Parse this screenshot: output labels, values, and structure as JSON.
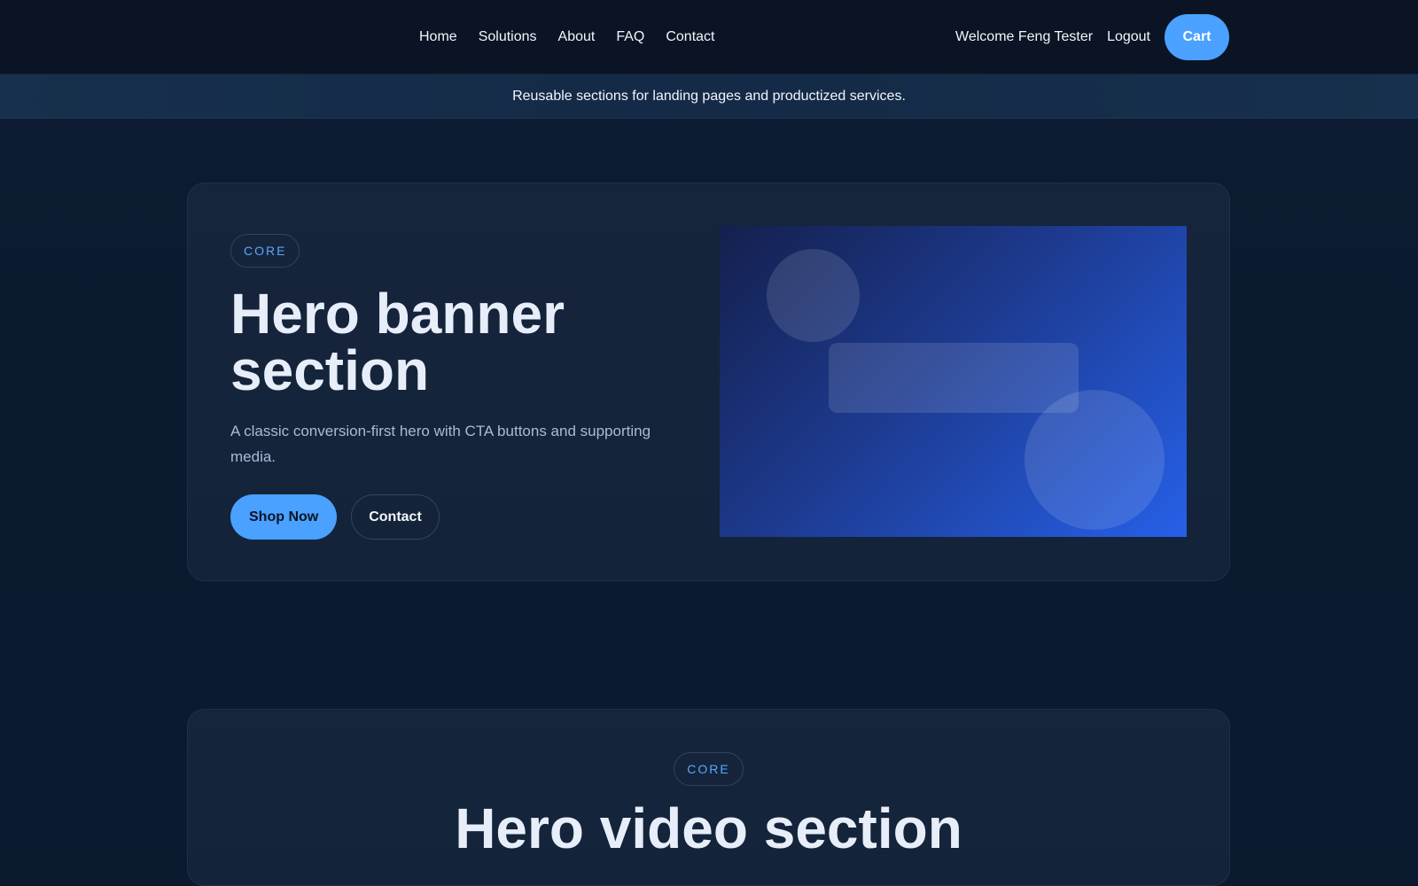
{
  "nav": {
    "links": [
      "Home",
      "Solutions",
      "About",
      "FAQ",
      "Contact"
    ],
    "welcome": "Welcome Feng Tester",
    "logout": "Logout",
    "cart": "Cart"
  },
  "subbar": {
    "text": "Reusable sections for landing pages and productized services."
  },
  "hero": {
    "badge": "CORE",
    "title_line1": "Hero banner",
    "title_line2": "section",
    "description": "A classic conversion-first hero with CTA buttons and supporting media.",
    "primary_cta": "Shop Now",
    "secondary_cta": "Contact"
  },
  "video": {
    "badge": "CORE",
    "title": "Hero video section"
  },
  "colors": {
    "accent": "#4aa1ff",
    "background": "#0c1a30",
    "nav_background": "#0a1424"
  }
}
